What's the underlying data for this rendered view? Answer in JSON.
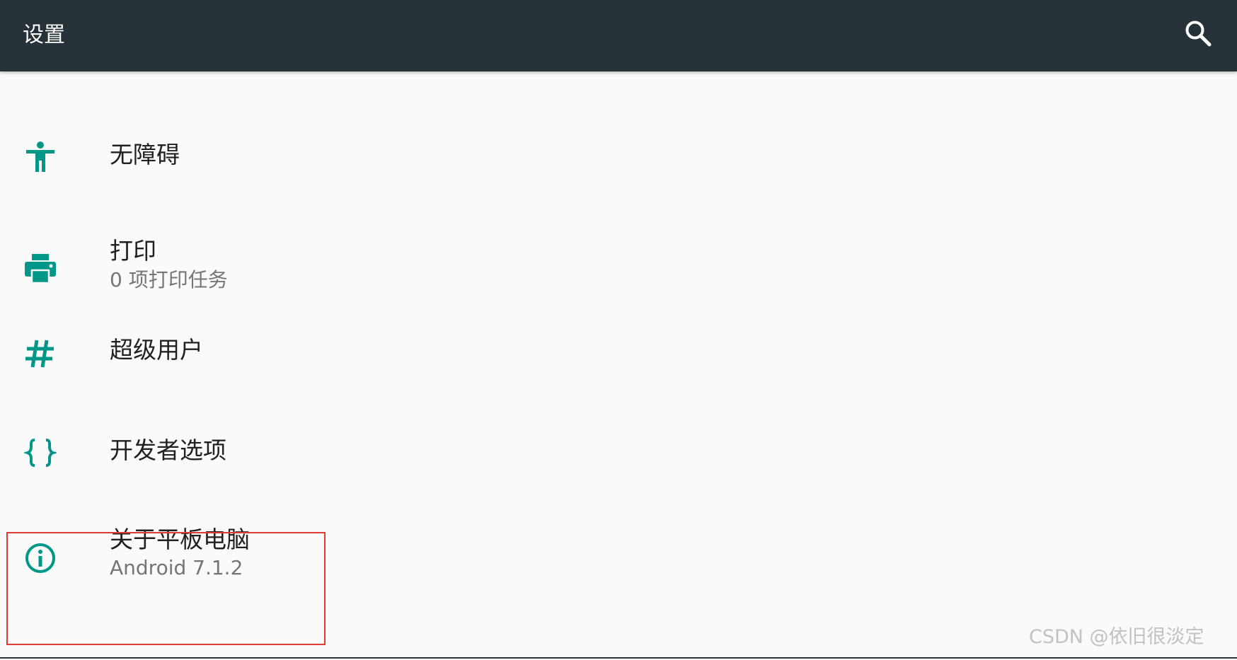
{
  "app_bar": {
    "title": "设置",
    "search_icon": "search-icon"
  },
  "settings_items": [
    {
      "icon": "accessibility-icon",
      "label": "无障碍",
      "sublabel": ""
    },
    {
      "icon": "print-icon",
      "label": "打印",
      "sublabel": "0 项打印任务"
    },
    {
      "icon": "hash-icon",
      "label": "超级用户",
      "sublabel": ""
    },
    {
      "icon": "braces-icon",
      "label": "开发者选项",
      "sublabel": ""
    },
    {
      "icon": "info-icon",
      "label": "关于平板电脑",
      "sublabel": "Android 7.1.2"
    }
  ],
  "watermark": "CSDN @依旧很淡定",
  "colors": {
    "app_bar_bg": "#263238",
    "accent_icon": "#009688",
    "page_bg": "#fafafa",
    "primary_text": "#212121",
    "secondary_text": "#757575",
    "highlight_border": "#e53935"
  }
}
